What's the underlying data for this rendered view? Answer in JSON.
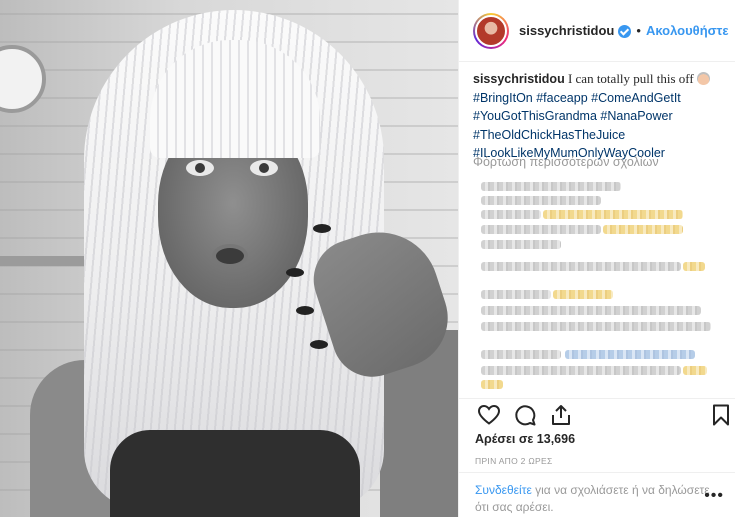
{
  "post": {
    "username": "sissychristidou",
    "separator": "•",
    "follow_label": "Ακολουθήστε"
  },
  "caption": {
    "username": "sissychristidou",
    "text": "I can totally pull this off",
    "hashtag_lines": [
      "#BringItOn #faceapp #ComeAndGetIt",
      "#YouGotThisGrandma #NanaPower",
      "#TheOldChickHasTheJuice",
      "#ILookLikeMyMumOnlyWayCooler"
    ]
  },
  "comments": {
    "load_more_label": "Φόρτωση περισσότερων σχολίων"
  },
  "engagement": {
    "likes_text": "Αρέσει σε 13,696",
    "time_ago": "ΠΡΙΝ ΑΠΟ 2 ΩΡΕΣ"
  },
  "footer": {
    "login_link": "Συνδεθείτε",
    "text_rest": "για να σχολιάσετε ή να δηλώσετε ότι σας αρέσει.",
    "more_label": "•••"
  },
  "icons": {
    "like": "heart-icon",
    "comment": "comment-icon",
    "share": "share-icon",
    "save": "bookmark-icon",
    "verified": "verified-badge-icon"
  },
  "colors": {
    "link_blue": "#3897f0",
    "hashtag_blue": "#003569",
    "muted_gray": "#999999",
    "border": "#efefef"
  }
}
